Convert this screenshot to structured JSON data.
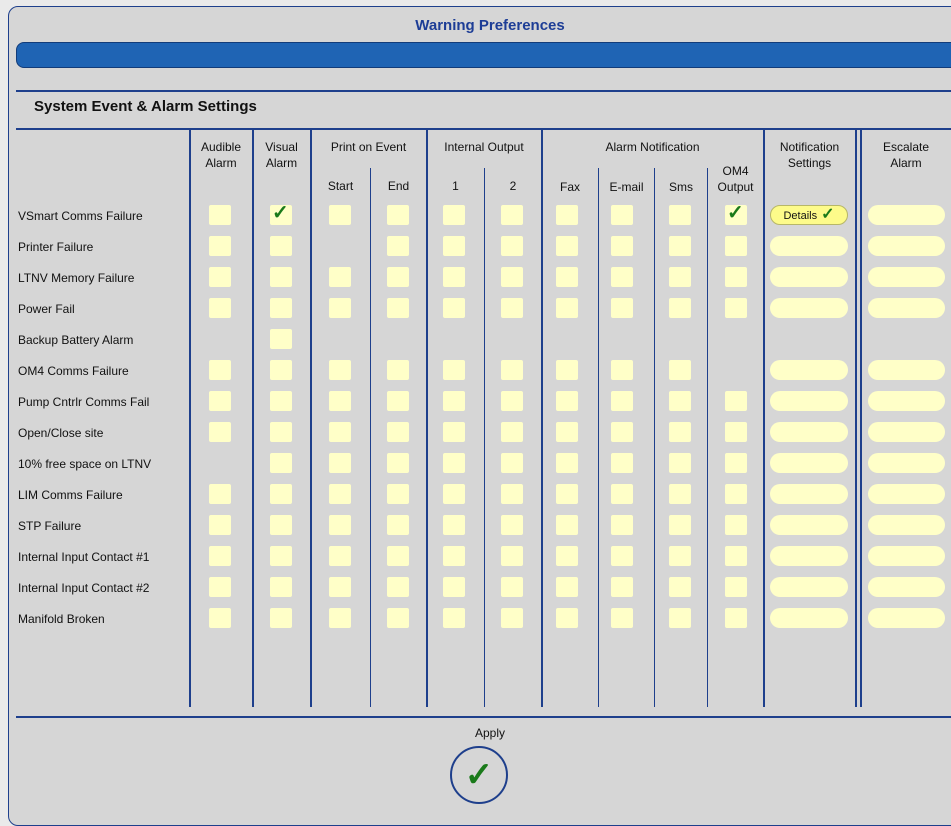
{
  "window": {
    "title": "Warning Preferences"
  },
  "section_title": "System Event & Alarm Settings",
  "headers": {
    "audible": "Audible\nAlarm",
    "visual": "Visual\nAlarm",
    "print": "Print on Event",
    "print_start": "Start",
    "print_end": "End",
    "internal": "Internal Output",
    "internal_1": "1",
    "internal_2": "2",
    "notification": "Alarm Notification",
    "fax": "Fax",
    "email": "E-mail",
    "sms": "Sms",
    "om4": "OM4\nOutput",
    "notif_settings": "Notification\nSettings",
    "escalate": "Escalate\nAlarm"
  },
  "details_label": "Details",
  "apply_label": "Apply",
  "colors": {
    "accent": "#1e3f8c",
    "checkbox": "#ffffc8",
    "check": "#1a7a1a",
    "bar": "#1f64b4"
  },
  "columns": [
    "audible",
    "visual",
    "start",
    "end",
    "out1",
    "out2",
    "fax",
    "email",
    "sms",
    "om4"
  ],
  "rows": [
    {
      "label": "VSmart Comms Failure",
      "cells": [
        1,
        2,
        1,
        1,
        1,
        1,
        1,
        1,
        1,
        2
      ],
      "notif": "details",
      "escalate": true
    },
    {
      "label": "Printer Failure",
      "cells": [
        1,
        1,
        0,
        1,
        1,
        1,
        1,
        1,
        1,
        1
      ],
      "notif": "pill",
      "escalate": true
    },
    {
      "label": "LTNV Memory Failure",
      "cells": [
        1,
        1,
        1,
        1,
        1,
        1,
        1,
        1,
        1,
        1
      ],
      "notif": "pill",
      "escalate": true
    },
    {
      "label": "Power Fail",
      "cells": [
        1,
        1,
        1,
        1,
        1,
        1,
        1,
        1,
        1,
        1
      ],
      "notif": "pill",
      "escalate": true
    },
    {
      "label": "Backup Battery Alarm",
      "cells": [
        0,
        1,
        0,
        0,
        0,
        0,
        0,
        0,
        0,
        0
      ],
      "notif": "none",
      "escalate": false
    },
    {
      "label": "OM4 Comms Failure",
      "cells": [
        1,
        1,
        1,
        1,
        1,
        1,
        1,
        1,
        1,
        0
      ],
      "notif": "pill",
      "escalate": true
    },
    {
      "label": "Pump Cntrlr Comms Fail",
      "cells": [
        1,
        1,
        1,
        1,
        1,
        1,
        1,
        1,
        1,
        1
      ],
      "notif": "pill",
      "escalate": true
    },
    {
      "label": "Open/Close site",
      "cells": [
        1,
        1,
        1,
        1,
        1,
        1,
        1,
        1,
        1,
        1
      ],
      "notif": "pill",
      "escalate": true
    },
    {
      "label": "10% free space on LTNV",
      "cells": [
        0,
        1,
        1,
        1,
        1,
        1,
        1,
        1,
        1,
        1
      ],
      "notif": "pill",
      "escalate": true
    },
    {
      "label": "LIM Comms Failure",
      "cells": [
        1,
        1,
        1,
        1,
        1,
        1,
        1,
        1,
        1,
        1
      ],
      "notif": "pill",
      "escalate": true
    },
    {
      "label": "STP Failure",
      "cells": [
        1,
        1,
        1,
        1,
        1,
        1,
        1,
        1,
        1,
        1
      ],
      "notif": "pill",
      "escalate": true
    },
    {
      "label": "Internal Input Contact #1",
      "cells": [
        1,
        1,
        1,
        1,
        1,
        1,
        1,
        1,
        1,
        1
      ],
      "notif": "pill",
      "escalate": true
    },
    {
      "label": "Internal Input Contact #2",
      "cells": [
        1,
        1,
        1,
        1,
        1,
        1,
        1,
        1,
        1,
        1
      ],
      "notif": "pill",
      "escalate": true
    },
    {
      "label": "Manifold Broken",
      "cells": [
        1,
        1,
        1,
        1,
        1,
        1,
        1,
        1,
        1,
        1
      ],
      "notif": "pill",
      "escalate": true
    }
  ]
}
